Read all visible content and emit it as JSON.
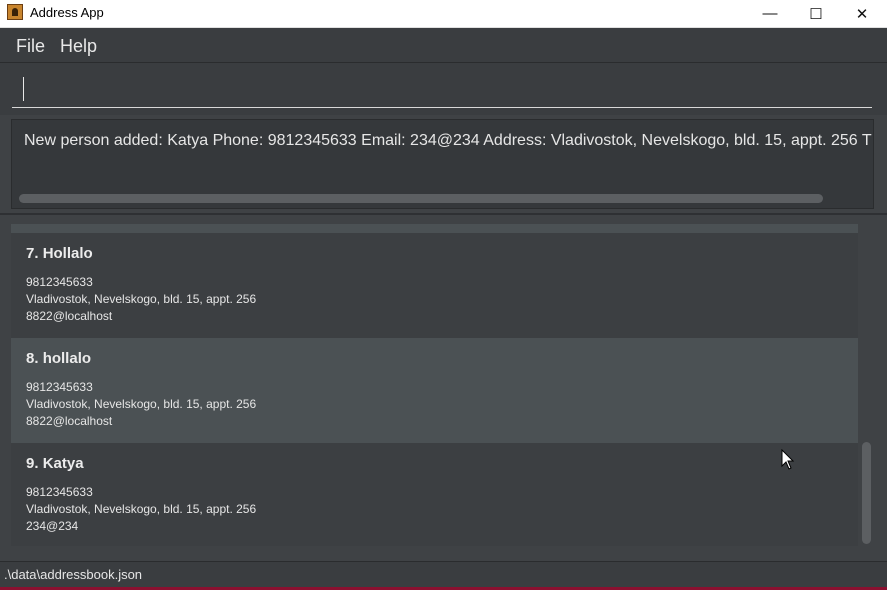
{
  "window": {
    "title": "Address App",
    "icon": "address-book-icon"
  },
  "controls": {
    "minimize": "—",
    "maximize": "☐",
    "close": "✕"
  },
  "menu": {
    "file": "File",
    "help": "Help"
  },
  "command": {
    "value": ""
  },
  "result": {
    "message": "New person added: Katya Phone: 9812345633 Email: 234@234 Address: Vladivostok, Nevelskogo, bld. 15, appt. 256 T"
  },
  "persons": [
    {
      "index": "7.",
      "name": "Hollalo",
      "phone": "9812345633",
      "address": "Vladivostok, Nevelskogo, bld. 15, appt. 256",
      "email": "8822@localhost"
    },
    {
      "index": "8.",
      "name": "hollalo",
      "phone": "9812345633",
      "address": "Vladivostok, Nevelskogo, bld. 15, appt. 256",
      "email": "8822@localhost"
    },
    {
      "index": "9.",
      "name": "Katya",
      "phone": "9812345633",
      "address": "Vladivostok, Nevelskogo, bld. 15, appt. 256",
      "email": "234@234"
    }
  ],
  "status": {
    "path": ".\\data\\addressbook.json"
  },
  "colors": {
    "background": "#3f4245",
    "card_odd": "#3c3f42",
    "card_even": "#4b5154",
    "text": "#e6e6e6"
  }
}
